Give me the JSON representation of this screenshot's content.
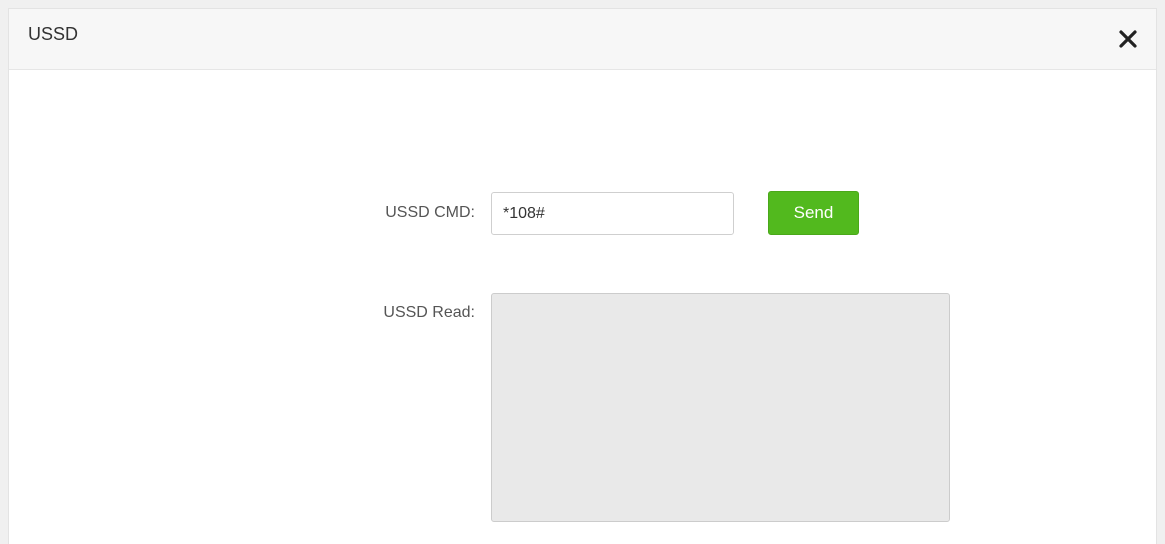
{
  "dialog": {
    "title": "USSD",
    "close_icon": "close-icon"
  },
  "form": {
    "cmd_label": "USSD CMD:",
    "cmd_value": "*108#",
    "send_label": "Send",
    "send_color": "#52b91e",
    "read_label": "USSD Read:",
    "read_value": ""
  }
}
